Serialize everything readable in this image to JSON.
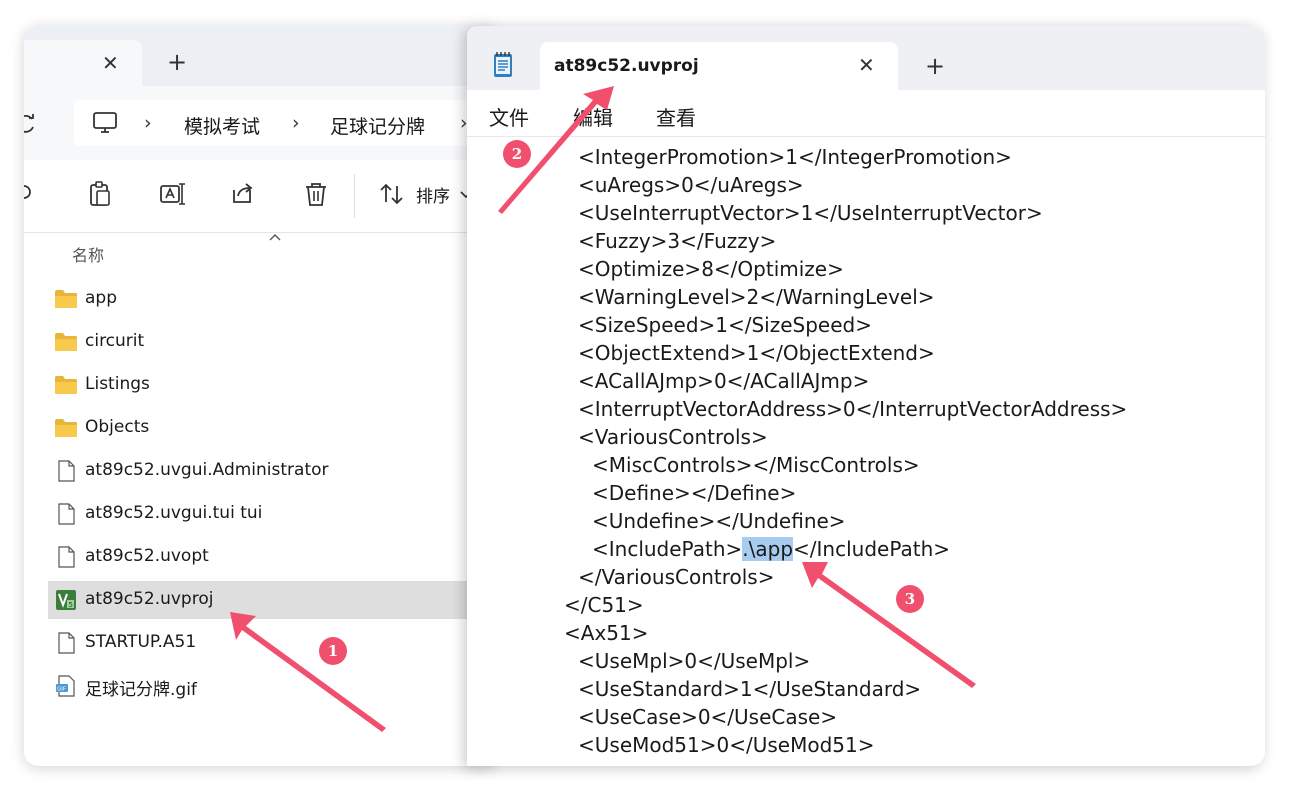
{
  "explorer": {
    "tab_close": "✕",
    "tab_new": "+",
    "breadcrumb": {
      "sep": "›",
      "items": [
        "模拟考试",
        "足球记分牌"
      ]
    },
    "toolbar": {
      "sort_label": "排序"
    },
    "column_header": "名称",
    "files": [
      {
        "name": "app",
        "type": "folder"
      },
      {
        "name": "circurit",
        "type": "folder"
      },
      {
        "name": "Listings",
        "type": "folder"
      },
      {
        "name": "Objects",
        "type": "folder"
      },
      {
        "name": "at89c52.uvgui.Administrator",
        "type": "file"
      },
      {
        "name": "at89c52.uvgui.tui tui",
        "type": "file"
      },
      {
        "name": "at89c52.uvopt",
        "type": "file"
      },
      {
        "name": "at89c52.uvproj",
        "type": "uvproj",
        "selected": true
      },
      {
        "name": "STARTUP.A51",
        "type": "file"
      },
      {
        "name": "足球记分牌.gif",
        "type": "image"
      }
    ]
  },
  "notepad": {
    "tab_title": "at89c52.uvproj",
    "tab_close": "✕",
    "tab_new": "+",
    "menu": [
      "文件",
      "编辑",
      "查看"
    ],
    "lines": [
      "<IntegerPromotion>1</IntegerPromotion>",
      "<uAregs>0</uAregs>",
      "<UseInterruptVector>1</UseInterruptVector>",
      "<Fuzzy>3</Fuzzy>",
      "<Optimize>8</Optimize>",
      "<WarningLevel>2</WarningLevel>",
      "<SizeSpeed>1</SizeSpeed>",
      "<ObjectExtend>1</ObjectExtend>",
      "<ACallAJmp>0</ACallAJmp>",
      "<InterruptVectorAddress>0</InterruptVectorAddress>",
      "<VariousControls>",
      "<MiscControls></MiscControls>",
      "<Define></Define>",
      "<Undefine></Undefine>",
      "<IncludePath>",
      "</VariousControls>",
      "</C51>",
      "<Ax51>",
      "<UseMpl>0</UseMpl>",
      "<UseStandard>1</UseStandard>",
      "<UseCase>0</UseCase>",
      "<UseMod51>0</UseMod51>",
      "<VariousControls>"
    ],
    "include_selected": ".\\app",
    "include_close": "</IncludePath>"
  },
  "annotations": {
    "color": "#f0506e",
    "badges": [
      "1",
      "2",
      "3"
    ]
  }
}
